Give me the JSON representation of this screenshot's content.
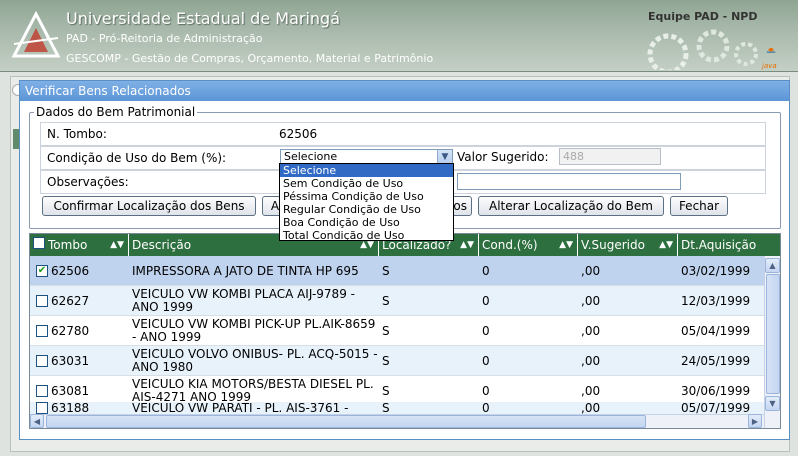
{
  "header": {
    "title": "Universidade Estadual de Maringá",
    "line1": "PAD - Pró-Reitoria de Administração",
    "line2": "GESCOMP - Gestão de Compras, Orçamento, Material e Patrimônio",
    "team": "Equipe PAD - NPD",
    "java_label": "java"
  },
  "dialog": {
    "title": "Verificar Bens Relacionados",
    "legend": "Dados do Bem Patrimonial",
    "tombo_label": "N. Tombo:",
    "tombo_value": "62506",
    "condicao_label": "Condição de Uso do Bem (%):",
    "condicao_selected": "Selecione",
    "valor_sugerido_label": "Valor Sugerido:",
    "valor_sugerido_value": "488",
    "observacoes_label": "Observações:",
    "dropdown_options": [
      "Selecione",
      "Sem Condição de Uso",
      "Péssima Condição de Uso",
      "Regular Condição de Uso",
      "Boa Condição de Uso",
      "Total Condição de Uso"
    ],
    "buttons": {
      "confirmar": "Confirmar Localização dos Bens",
      "alterar_partial": "A",
      "btn_hidden_tail": "os",
      "alterar_bem": "Alterar Localização do Bem",
      "fechar": "Fechar"
    }
  },
  "grid": {
    "columns": [
      "Tombo",
      "Descrição",
      "Localizado?",
      "Cond.(%)",
      "V.Sugerido",
      "Dt.Aquisição"
    ],
    "rows": [
      {
        "checked": true,
        "tombo": "62506",
        "descricao": "IMPRESSORA A JATO DE TINTA HP 695",
        "localizado": "S",
        "cond": "0",
        "vsugerido": ",00",
        "dt": "03/02/1999"
      },
      {
        "checked": false,
        "tombo": "62627",
        "descricao": "VEICULO VW KOMBI PLACA AIJ-9789 - ANO 1999",
        "localizado": "S",
        "cond": "0",
        "vsugerido": ",00",
        "dt": "12/03/1999"
      },
      {
        "checked": false,
        "tombo": "62780",
        "descricao": "VEICULO VW KOMBI PICK-UP PL.AIK-8659 - ANO 1999",
        "localizado": "S",
        "cond": "0",
        "vsugerido": ",00",
        "dt": "05/04/1999"
      },
      {
        "checked": false,
        "tombo": "63031",
        "descricao": "VEICULO VOLVO ONIBUS- PL. ACQ-5015 - ANO 1980",
        "localizado": "S",
        "cond": "0",
        "vsugerido": ",00",
        "dt": "24/05/1999"
      },
      {
        "checked": false,
        "tombo": "63081",
        "descricao": "VEICULO KIA MOTORS/BESTA DIESEL PL. AIS-4271 ANO 1999",
        "localizado": "S",
        "cond": "0",
        "vsugerido": ",00",
        "dt": "30/06/1999"
      },
      {
        "checked": false,
        "tombo": "63188",
        "descricao": "VEICULO VW PARATI - PL. AIS-3761 -",
        "localizado": "S",
        "cond": "0",
        "vsugerido": ",00",
        "dt": "05/07/1999"
      }
    ]
  },
  "colors": {
    "header_green": "#2e6f40",
    "title_blue": "#5c95d6",
    "selected_row": "#bfd3ee"
  }
}
